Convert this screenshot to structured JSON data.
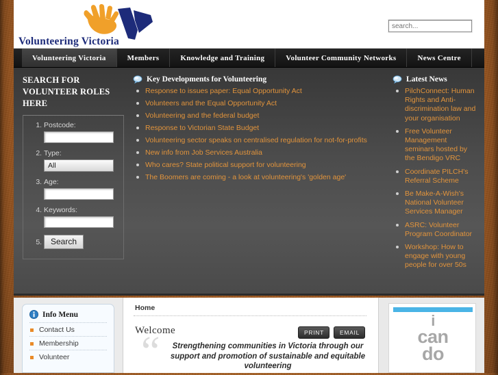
{
  "header": {
    "logo_text": "Volunteering Victoria",
    "logo_icons": [
      "orange-hand-icon",
      "blue-v-icon"
    ],
    "search_placeholder": "search...",
    "search_value": ""
  },
  "nav": {
    "items": [
      {
        "label": "Volunteering Victoria",
        "active": true
      },
      {
        "label": "Members",
        "active": false
      },
      {
        "label": "Knowledge and Training",
        "active": false
      },
      {
        "label": "Volunteer Community Networks",
        "active": false
      },
      {
        "label": "News Centre",
        "active": false
      }
    ]
  },
  "volunteer_search": {
    "title": "SEARCH FOR VOLUNTEER ROLES HERE",
    "fields": [
      {
        "label": "Postcode:",
        "type": "text",
        "value": ""
      },
      {
        "label": "Type:",
        "type": "select",
        "value": "All"
      },
      {
        "label": "Age:",
        "type": "text",
        "value": ""
      },
      {
        "label": "Keywords:",
        "type": "text",
        "value": ""
      }
    ],
    "submit_label": "Search"
  },
  "key_developments": {
    "icon": "speech-bubble-icon",
    "title": "Key Developments for Volunteering",
    "items": [
      "Response to issues paper: Equal Opportunity Act",
      "Volunteers and the Equal Opportunity Act",
      "Volunteering and the federal budget",
      "Response to Victorian State Budget",
      "Volunteering sector speaks on centralised regulation for not-for-profits",
      "New info from Job Services Australia",
      "Who cares? State political support for volunteering",
      "The Boomers are coming - a look at volunteering's 'golden age'"
    ]
  },
  "latest_news": {
    "icon": "speech-bubble-icon",
    "title": "Latest News",
    "items": [
      "PilchConnect: Human Rights and Anti-discrimination law and your organisation",
      "Free Volunteer Management seminars hosted by the Bendigo VRC",
      "Coordinate PILCH's Referral Scheme",
      "Be Make-A-Wish's National Volunteer Services Manager",
      "ASRC: Volunteer Program Coordinator",
      "Workshop: How to engage with young people for over 50s"
    ]
  },
  "info_menu": {
    "icon": "info-icon",
    "title": "Info Menu",
    "items": [
      "Contact Us",
      "Membership",
      "Volunteer"
    ]
  },
  "content": {
    "breadcrumb": "Home",
    "heading": "Welcome",
    "print_label": "PRINT",
    "email_label": "EMAIL",
    "quote_mark": "“",
    "tagline": "Strengthening communities in Victoria through our support and promotion of sustainable and equitable volunteering"
  },
  "promo": {
    "line1": "i",
    "line2": "can",
    "line3": "do",
    "accent_color": "#4ab4e6"
  },
  "colors": {
    "page_background": "#9a561f",
    "nav_background": "#1d1d1d",
    "dark_panel": "#4c4c4c",
    "link_orange": "#e2943c",
    "logo_blue": "#1d2b7a",
    "logo_orange": "#f0a02a",
    "bullet_orange": "#e98a28"
  }
}
